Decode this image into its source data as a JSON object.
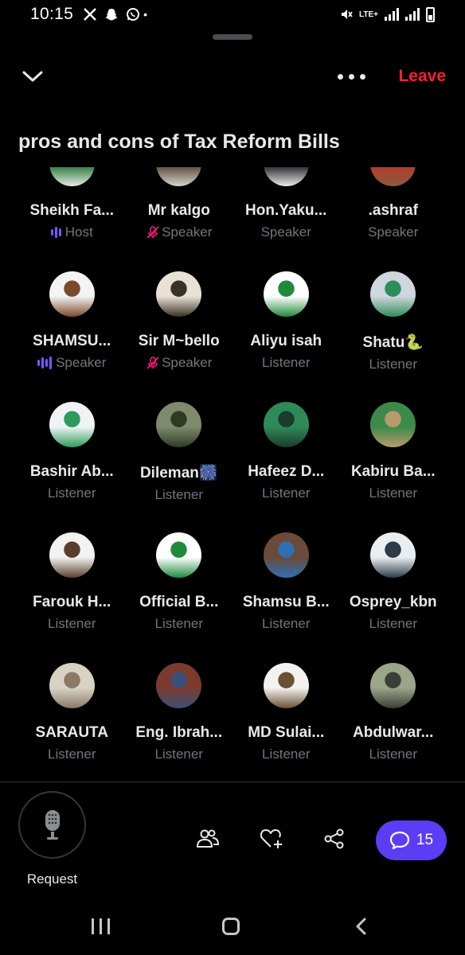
{
  "status": {
    "time": "10:15",
    "left_icons": [
      "x-icon",
      "snapchat-icon",
      "whatsapp-icon"
    ],
    "dot": "•",
    "network": "LTE+"
  },
  "header": {
    "leave_label": "Leave",
    "leave_color": "#f4212e"
  },
  "space": {
    "title": "pros and cons of Tax Reform Bills"
  },
  "participants": [
    {
      "name": "Sheikh Fa...",
      "role": "Host",
      "role_icon": "host-wave-icon",
      "avatar_colors": [
        "#2a7a3b",
        "#e8e8e8"
      ]
    },
    {
      "name": "Mr kalgo",
      "role": "Speaker",
      "role_icon": "mic-muted-icon",
      "avatar_colors": [
        "#5a4a3a",
        "#d7d3cc"
      ]
    },
    {
      "name": "Hon.Yaku...",
      "role": "Speaker",
      "role_icon": "",
      "avatar_colors": [
        "#22252b",
        "#f0ece6"
      ]
    },
    {
      "name": ".ashraf",
      "role": "Speaker",
      "role_icon": "",
      "avatar_colors": [
        "#b33b2b",
        "#8c5a3c"
      ]
    },
    {
      "name": "SHAMSU...",
      "role": "Speaker",
      "role_icon": "speaking-wave-icon",
      "avatar_colors": [
        "#f3f3f3",
        "#7a4a2a"
      ]
    },
    {
      "name": "Sir M~bello",
      "role": "Speaker",
      "role_icon": "mic-muted-icon",
      "avatar_colors": [
        "#e8e2d6",
        "#3a3026"
      ]
    },
    {
      "name": "Aliyu isah",
      "role": "Listener",
      "role_icon": "",
      "avatar_colors": [
        "#ffffff",
        "#1f8b3a"
      ]
    },
    {
      "name": "Shatu🐍",
      "role": "Listener",
      "role_icon": "",
      "avatar_colors": [
        "#cfd6dd",
        "#2d8d58"
      ]
    },
    {
      "name": "Bashir Ab...",
      "role": "Listener",
      "role_icon": "",
      "avatar_colors": [
        "#f0f3f6",
        "#2e9a5b"
      ]
    },
    {
      "name": "Dileman🎆",
      "role": "Listener",
      "role_icon": "",
      "avatar_colors": [
        "#7e8a6b",
        "#2f3a25"
      ]
    },
    {
      "name": "Hafeez D...",
      "role": "Listener",
      "role_icon": "",
      "avatar_colors": [
        "#2e8a59",
        "#1a3c2b"
      ]
    },
    {
      "name": "Kabiru Ba...",
      "role": "Listener",
      "role_icon": "",
      "avatar_colors": [
        "#3c8a4a",
        "#b99b6b"
      ]
    },
    {
      "name": "Farouk H...",
      "role": "Listener",
      "role_icon": "",
      "avatar_colors": [
        "#f2f2f2",
        "#5a3e2b"
      ]
    },
    {
      "name": "Official B...",
      "role": "Listener",
      "role_icon": "",
      "avatar_colors": [
        "#ffffff",
        "#1f8b3a"
      ]
    },
    {
      "name": "Shamsu B...",
      "role": "Listener",
      "role_icon": "",
      "avatar_colors": [
        "#6b4a3a",
        "#2f6fb3"
      ]
    },
    {
      "name": "Osprey_kbn",
      "role": "Listener",
      "role_icon": "",
      "avatar_colors": [
        "#e9eef2",
        "#2d3a47"
      ]
    },
    {
      "name": "SARAUTA",
      "role": "Listener",
      "role_icon": "",
      "avatar_colors": [
        "#d9d2c4",
        "#8a7a66"
      ]
    },
    {
      "name": "Eng. Ibrah...",
      "role": "Listener",
      "role_icon": "",
      "avatar_colors": [
        "#7a3b2e",
        "#3b4f7a"
      ]
    },
    {
      "name": "MD Sulai...",
      "role": "Listener",
      "role_icon": "",
      "avatar_colors": [
        "#f4f2ee",
        "#6a5034"
      ]
    },
    {
      "name": "Abdulwar...",
      "role": "Listener",
      "role_icon": "",
      "avatar_colors": [
        "#9aa58a",
        "#3b3f36"
      ]
    }
  ],
  "bottom": {
    "request_label": "Request",
    "comment_count": "15",
    "accent": "#5b3df5"
  }
}
